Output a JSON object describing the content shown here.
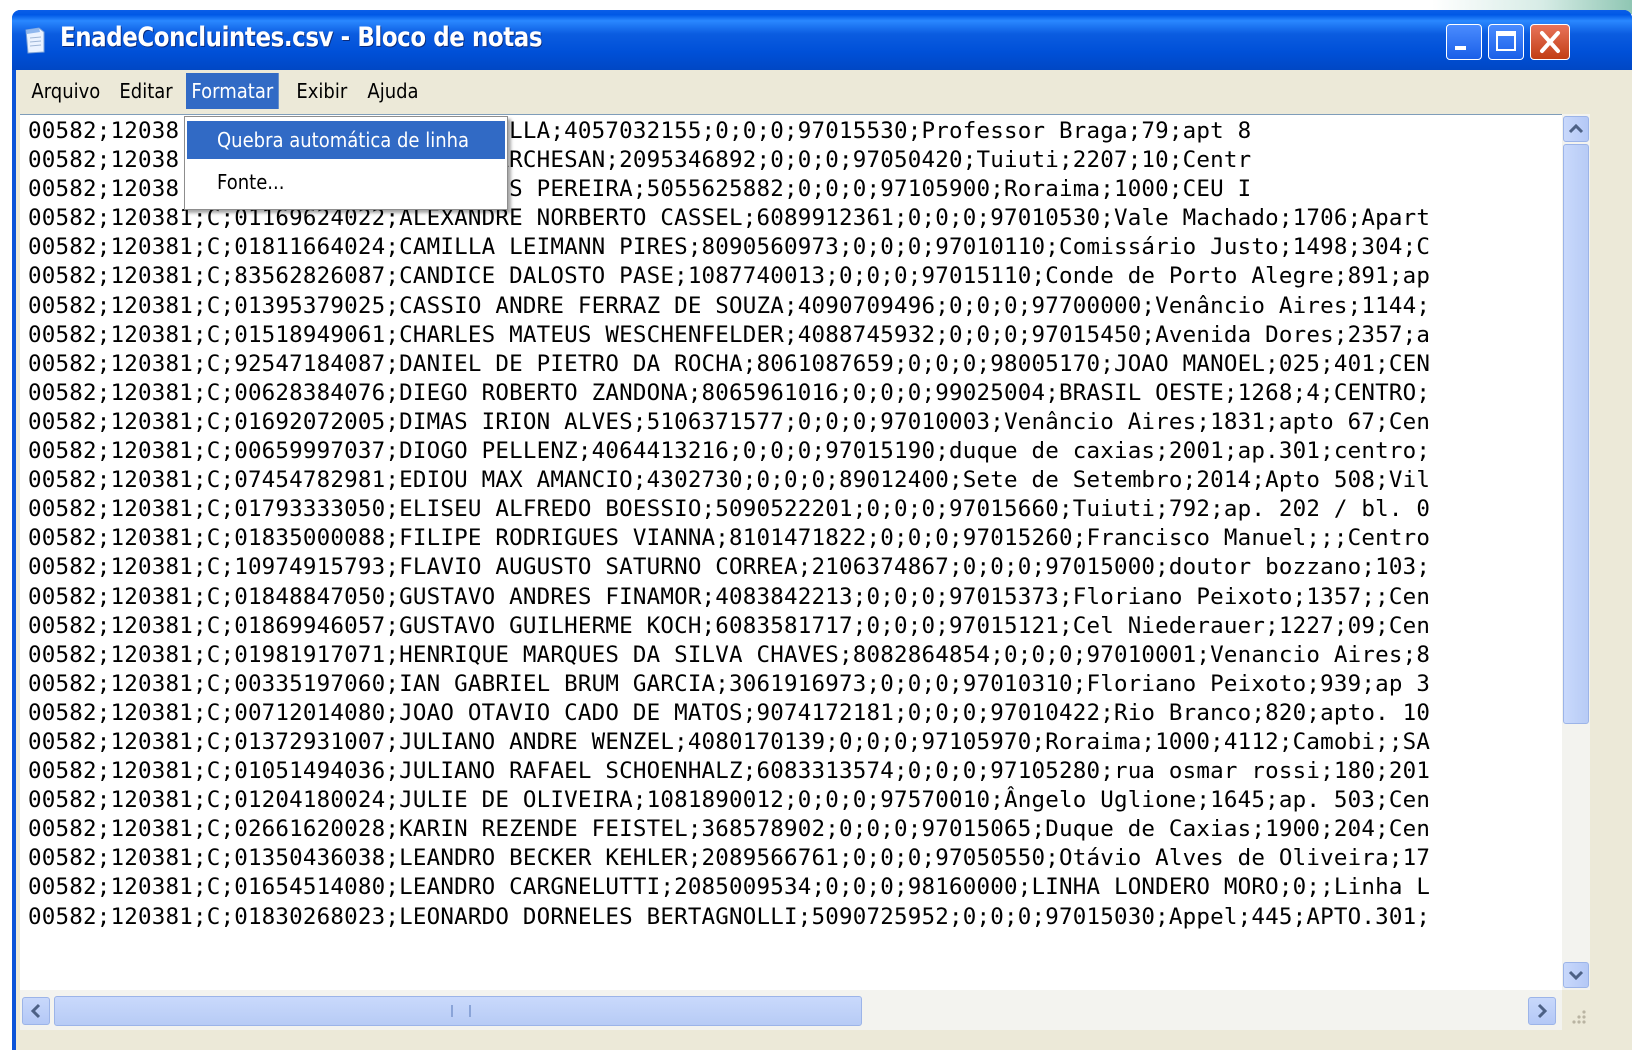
{
  "window": {
    "title": "EnadeConcluintes.csv - Bloco de notas"
  },
  "colors": {
    "titlebar": "#0058e6",
    "menu_highlight": "#316ac5",
    "close_button": "#c23e14",
    "scroll_thumb": "#c1d3fb"
  },
  "icons": {
    "app": "notepad-icon",
    "minimize": "minimize-icon",
    "maximize": "maximize-icon",
    "close": "close-icon",
    "scroll_up": "chevron-up-icon",
    "scroll_down": "chevron-down-icon",
    "scroll_left": "chevron-left-icon",
    "scroll_right": "chevron-right-icon"
  },
  "menu": {
    "items": [
      "Arquivo",
      "Editar",
      "Formatar",
      "Exibir",
      "Ajuda"
    ],
    "active": "Formatar"
  },
  "dropdown": {
    "items": [
      {
        "label": "Quebra automática de linha",
        "highlighted": true
      },
      {
        "label": "Fonte...",
        "highlighted": false
      }
    ]
  },
  "editor": {
    "lines": [
      "00582;12038 ;C;0183 N JOSE RAMBO PILLA;4057032155;0;0;0;97015530;Professor Braga;79;apt 8",
      "00582;12038 ;C;0183 O CAVALHEIRO MARCHESAN;2095346892;0;0;0;97050420;Tuiuti;2207;10;Centr",
      "00582;12038 ;C;0183 R MARIANO SANTOS PEREIRA;5055625882;0;0;0;97105900;Roraima;1000;CEU I",
      "00582;120381;C;01169624022;ALEXANDRE NORBERTO CASSEL;6089912361;0;0;0;97010530;Vale Machado;1706;Apart",
      "00582;120381;C;01811664024;CAMILLA LEIMANN PIRES;8090560973;0;0;0;97010110;Comissário Justo;1498;304;C",
      "00582;120381;C;83562826087;CANDICE DALOSTO PASE;1087740013;0;0;0;97015110;Conde de Porto Alegre;891;ap",
      "00582;120381;C;01395379025;CASSIO ANDRE FERRAZ DE SOUZA;4090709496;0;0;0;97700000;Venâncio Aires;1144;",
      "00582;120381;C;01518949061;CHARLES MATEUS WESCHENFELDER;4088745932;0;0;0;97015450;Avenida Dores;2357;a",
      "00582;120381;C;92547184087;DANIEL DE PIETRO DA ROCHA;8061087659;0;0;0;98005170;JOAO MANOEL;025;401;CEN",
      "00582;120381;C;00628384076;DIEGO ROBERTO ZANDONA;8065961016;0;0;0;99025004;BRASIL OESTE;1268;4;CENTRO;",
      "00582;120381;C;01692072005;DIMAS IRION ALVES;5106371577;0;0;0;97010003;Venâncio Aires;1831;apto 67;Cen",
      "00582;120381;C;00659997037;DIOGO PELLENZ;4064413216;0;0;0;97015190;duque de caxias;2001;ap.301;centro;",
      "00582;120381;C;07454782981;EDIOU MAX AMANCIO;4302730;0;0;0;89012400;Sete de Setembro;2014;Apto 508;Vil",
      "00582;120381;C;01793333050;ELISEU ALFREDO BOESSIO;5090522201;0;0;0;97015660;Tuiuti;792;ap. 202 / bl. 0",
      "00582;120381;C;01835000088;FILIPE RODRIGUES VIANNA;8101471822;0;0;0;97015260;Francisco Manuel;;;Centro",
      "00582;120381;C;10974915793;FLAVIO AUGUSTO SATURNO CORREA;2106374867;0;0;0;97015000;doutor bozzano;103;",
      "00582;120381;C;01848847050;GUSTAVO ANDRES FINAMOR;4083842213;0;0;0;97015373;Floriano Peixoto;1357;;Cen",
      "00582;120381;C;01869946057;GUSTAVO GUILHERME KOCH;6083581717;0;0;0;97015121;Cel Niederauer;1227;09;Cen",
      "00582;120381;C;01981917071;HENRIQUE MARQUES DA SILVA CHAVES;8082864854;0;0;0;97010001;Venancio Aires;8",
      "00582;120381;C;00335197060;IAN GABRIEL BRUM GARCIA;3061916973;0;0;0;97010310;Floriano Peixoto;939;ap 3",
      "00582;120381;C;00712014080;JOAO OTAVIO CADO DE MATOS;9074172181;0;0;0;97010422;Rio Branco;820;apto. 10",
      "00582;120381;C;01372931007;JULIANO ANDRE WENZEL;4080170139;0;0;0;97105970;Roraima;1000;4112;Camobi;;SA",
      "00582;120381;C;01051494036;JULIANO RAFAEL SCHOENHALZ;6083313574;0;0;0;97105280;rua osmar rossi;180;201",
      "00582;120381;C;01204180024;JULIE DE OLIVEIRA;1081890012;0;0;0;97570010;Ângelo Uglione;1645;ap. 503;Cen",
      "00582;120381;C;02661620028;KARIN REZENDE FEISTEL;368578902;0;0;0;97015065;Duque de Caxias;1900;204;Cen",
      "00582;120381;C;01350436038;LEANDRO BECKER KEHLER;2089566761;0;0;0;97050550;Otávio Alves de Oliveira;17",
      "00582;120381;C;01654514080;LEANDRO CARGNELUTTI;2085009534;0;0;0;98160000;LINHA LONDERO MORO;0;;Linha L",
      "00582;120381;C;01830268023;LEONARDO DORNELES BERTAGNOLLI;5090725952;0;0;0;97015030;Appel;445;APTO.301;"
    ]
  }
}
